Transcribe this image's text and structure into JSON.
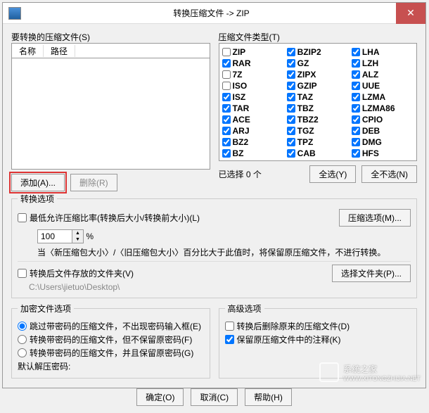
{
  "titlebar": {
    "title": "转换压缩文件 -> ZIP"
  },
  "filesGroup": {
    "label": "要转换的压缩文件(S)",
    "colName": "名称",
    "colPath": "路径",
    "add": "添加(A)...",
    "remove": "删除(R)"
  },
  "typeGroup": {
    "label": "压缩文件类型(T)",
    "items": [
      {
        "n": "ZIP",
        "c": false
      },
      {
        "n": "BZIP2",
        "c": true
      },
      {
        "n": "LHA",
        "c": true
      },
      {
        "n": "RAR",
        "c": true
      },
      {
        "n": "GZ",
        "c": true
      },
      {
        "n": "LZH",
        "c": true
      },
      {
        "n": "7Z",
        "c": false
      },
      {
        "n": "ZIPX",
        "c": true
      },
      {
        "n": "ALZ",
        "c": true
      },
      {
        "n": "ISO",
        "c": false
      },
      {
        "n": "GZIP",
        "c": true
      },
      {
        "n": "UUE",
        "c": true
      },
      {
        "n": "ISZ",
        "c": true
      },
      {
        "n": "TAZ",
        "c": true
      },
      {
        "n": "LZMA",
        "c": true
      },
      {
        "n": "TAR",
        "c": true
      },
      {
        "n": "TBZ",
        "c": true
      },
      {
        "n": "LZMA86",
        "c": true
      },
      {
        "n": "ACE",
        "c": true
      },
      {
        "n": "TBZ2",
        "c": true
      },
      {
        "n": "CPIO",
        "c": true
      },
      {
        "n": "ARJ",
        "c": true
      },
      {
        "n": "TGZ",
        "c": true
      },
      {
        "n": "DEB",
        "c": true
      },
      {
        "n": "BZ2",
        "c": true
      },
      {
        "n": "TPZ",
        "c": true
      },
      {
        "n": "DMG",
        "c": true
      },
      {
        "n": "BZ",
        "c": true
      },
      {
        "n": "CAB",
        "c": true
      },
      {
        "n": "HFS",
        "c": true
      }
    ],
    "selected": "已选择 0 个",
    "selectAll": "全选(Y)",
    "selectNone": "全不选(N)"
  },
  "convert": {
    "label": "转换选项",
    "ratio": "最低允许压缩比率(转换后大小/转换前大小)(L)",
    "ratioVal": "100",
    "pct": "%",
    "note": "当〈新压缩包大小〉/〈旧压缩包大小〉百分比大于此值时，将保留原压缩文件，不进行转换。",
    "folder": "转换后文件存放的文件夹(V)",
    "folderPath": "C:\\Users\\jietuo\\Desktop\\",
    "compressOpt": "压缩选项(M)...",
    "folderBtn": "选择文件夹(P)..."
  },
  "encrypt": {
    "label": "加密文件选项",
    "r1": "跳过带密码的压缩文件，不出现密码输入框(E)",
    "r2": "转换带密码的压缩文件，但不保留原密码(F)",
    "r3": "转换带密码的压缩文件，并且保留原密码(G)",
    "defaultPwd": "默认解压密码:"
  },
  "advanced": {
    "label": "高级选项",
    "c1": "转换后删除原来的压缩文件(D)",
    "c2": "保留原压缩文件中的注释(K)"
  },
  "bottom": {
    "ok": "确定(O)",
    "cancel": "取消(C)",
    "help": "帮助(H)"
  },
  "watermark": {
    "text": "系统之家",
    "url": "WWW.XITONGZHIJIA.NET"
  }
}
